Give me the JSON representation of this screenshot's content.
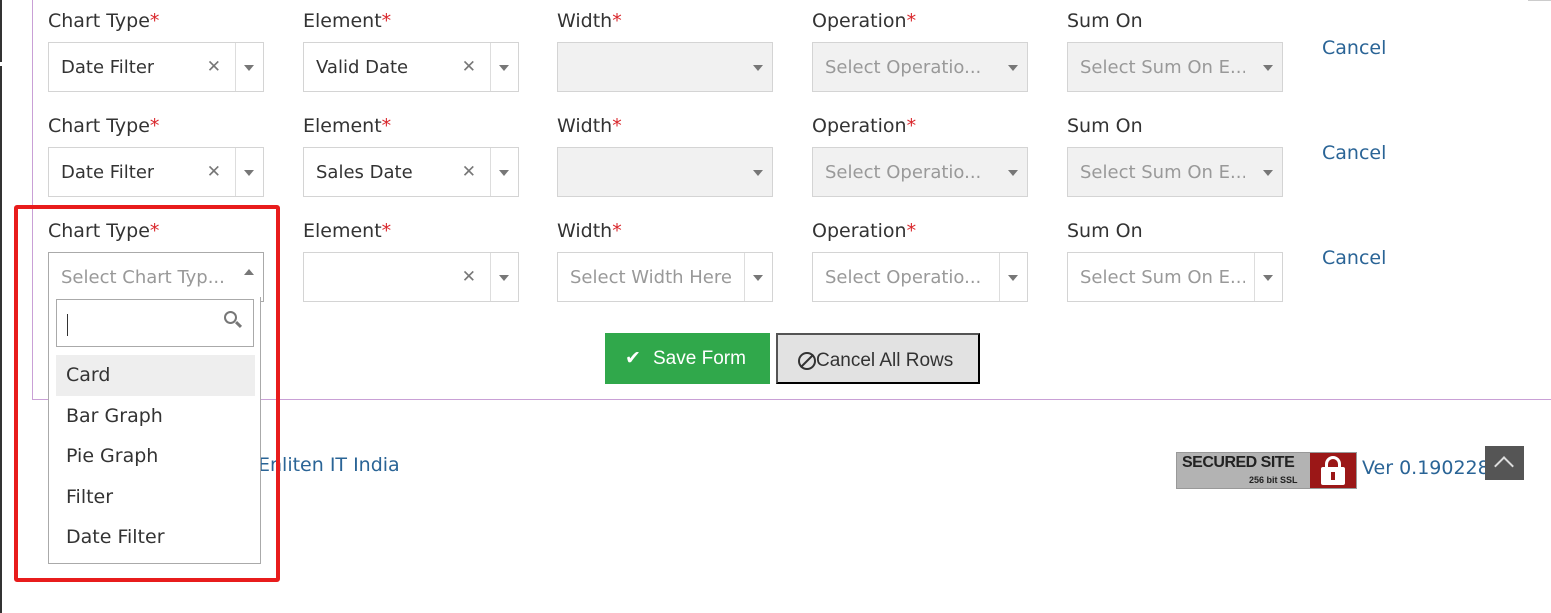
{
  "labels": {
    "chart_type": "Chart Type",
    "element": "Element",
    "width": "Width",
    "operation": "Operation",
    "sum_on": "Sum On",
    "required_mark": "*"
  },
  "rows": [
    {
      "chart_type": "Date Filter",
      "element": "Valid Date",
      "width": "",
      "operation": "Select Operatio...",
      "sum_on": "Select Sum On E...",
      "cancel": "Cancel"
    },
    {
      "chart_type": "Date Filter",
      "element": "Sales Date",
      "width": "",
      "operation": "Select Operatio...",
      "sum_on": "Select Sum On E...",
      "cancel": "Cancel"
    },
    {
      "chart_type": "Select Chart Typ...",
      "element": "",
      "width": "Select Width Here",
      "operation": "Select Operatio...",
      "sum_on": "Select Sum On E...",
      "cancel": "Cancel"
    }
  ],
  "dropdown": {
    "search_value": "",
    "options": [
      "Card",
      "Bar Graph",
      "Pie Graph",
      "Filter",
      "Date Filter"
    ],
    "highlighted": "Card"
  },
  "buttons": {
    "save": "Save Form",
    "cancel_all": "Cancel All Rows"
  },
  "footer": {
    "company": "Enliten IT India",
    "ssl_title": "SECURED SITE",
    "ssl_sub": "256 bit SSL",
    "version": "Ver 0.190228"
  },
  "colors": {
    "required": "#d9262b",
    "link": "#2a6496",
    "save_button": "#30a84b",
    "highlight_box": "#e81c1c",
    "panel_border": "#c9a0d6"
  },
  "icons": {
    "clear": "times-icon",
    "caret": "caret-down-icon",
    "search": "search-icon",
    "check": "check-icon",
    "ban": "ban-icon",
    "lock": "lock-icon",
    "scroll_top": "chevron-up-icon"
  }
}
